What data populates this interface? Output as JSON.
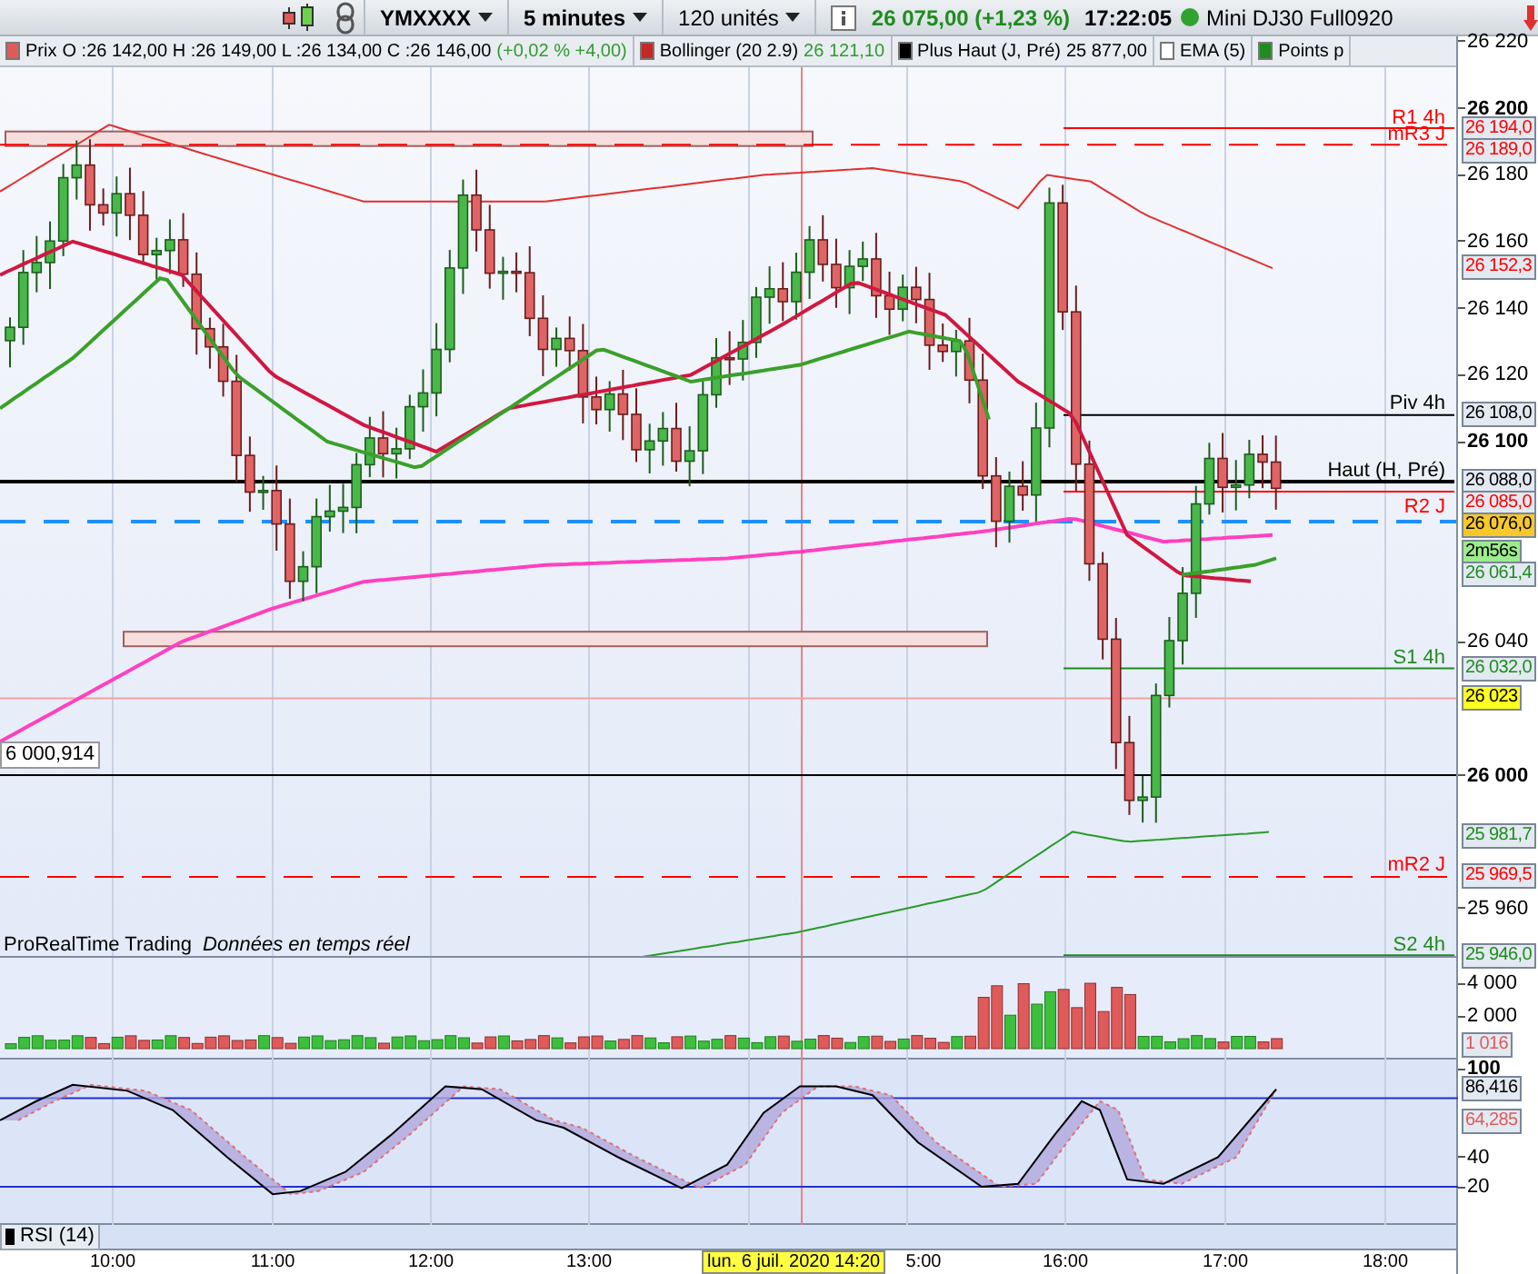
{
  "toolbar": {
    "symbol": "YMXXXX",
    "interval": "5 minutes",
    "units": "120 unités",
    "quote": "26 075,00 (+1,23 %)",
    "time": "17:22:05",
    "instrument": "Mini DJ30 Full0920"
  },
  "legend": [
    {
      "kind": "price",
      "label": "Prix",
      "text": "O :26 142,00 H :26 149,00 L :26 134,00 C :26 146,00",
      "value": "(+0,02 % +4,00)",
      "color": "#e05a5a"
    },
    {
      "kind": "indicator",
      "label": "Bollinger (20 2.9)",
      "value": "26 121,10",
      "color": "#c62828"
    },
    {
      "kind": "plain",
      "label": "Plus Haut (J, Pré)",
      "value": "25 877,00",
      "color": "#000000"
    },
    {
      "kind": "plain",
      "label": "EMA (5)",
      "color": "#ffffff"
    },
    {
      "kind": "plain",
      "label": "Points p",
      "color": "#1e8c1e"
    }
  ],
  "level_labels": [
    {
      "label": "R1 4h",
      "color": "#ff0000"
    },
    {
      "label": "mR3 J",
      "color": "#ff0000"
    },
    {
      "label": "Piv 4h",
      "color": "#000000"
    },
    {
      "label": "Haut (H, Pré)",
      "color": "#000000"
    },
    {
      "label": "R2 J",
      "color": "#ff0000"
    },
    {
      "label": "S1 4h",
      "color": "#1e8c1e"
    },
    {
      "label": "mR2 J",
      "color": "#ff0000"
    },
    {
      "label": "S2 4h",
      "color": "#1e8c1e"
    }
  ],
  "cursor_value": "6 000,914",
  "source": {
    "name": "ProRealTime Trading",
    "note": "Données en temps réel"
  },
  "rsi_label": "RSI (14)",
  "price_axis": {
    "main": {
      "ticks": [
        {
          "label": "26 220",
          "major": false
        },
        {
          "label": "26 200",
          "major": true
        },
        {
          "label": "26 180",
          "major": false
        },
        {
          "label": "26 160",
          "major": false
        },
        {
          "label": "26 140",
          "major": false
        },
        {
          "label": "26 120",
          "major": false
        },
        {
          "label": "26 100",
          "major": true
        },
        {
          "label": "26 040",
          "major": false
        },
        {
          "label": "26 000",
          "major": true
        },
        {
          "label": "25 960",
          "major": false
        }
      ],
      "badges": [
        {
          "label": "26 194,0",
          "kind": "level",
          "color": "#ff0000"
        },
        {
          "label": "26 189,0",
          "kind": "level",
          "color": "#ff0000"
        },
        {
          "label": "26 152,3",
          "kind": "level",
          "color": "#ff0000"
        },
        {
          "label": "26 108,0",
          "kind": "level",
          "color": "#000000"
        },
        {
          "label": "26 088,0",
          "kind": "level",
          "color": "#000000"
        },
        {
          "label": "26 085,0",
          "kind": "level",
          "color": "#ff0000"
        },
        {
          "label": "26 076,0",
          "kind": "current"
        },
        {
          "label": "2m56s",
          "kind": "countdown"
        },
        {
          "label": "26 061,4",
          "kind": "level",
          "color": "#1e8c1e"
        },
        {
          "label": "26 032,0",
          "kind": "level",
          "color": "#1e8c1e"
        },
        {
          "label": "26 023",
          "kind": "marker"
        },
        {
          "label": "25 981,7",
          "kind": "level",
          "color": "#1e8c1e"
        },
        {
          "label": "25 969,5",
          "kind": "level",
          "color": "#ff0000"
        },
        {
          "label": "25 946,0",
          "kind": "level",
          "color": "#1e8c1e"
        }
      ]
    },
    "volume": {
      "ticks": [
        {
          "label": "4 000",
          "major": false
        },
        {
          "label": "2 000",
          "major": false
        }
      ],
      "badges": [
        {
          "label": "1 016",
          "color": "#e05a5a"
        }
      ]
    },
    "rsi": {
      "ticks": [
        {
          "label": "100",
          "major": true
        },
        {
          "label": "40",
          "major": false
        },
        {
          "label": "20",
          "major": false
        }
      ],
      "badges": [
        {
          "label": "86,416",
          "color": "#000000"
        },
        {
          "label": "64,285",
          "color": "#e05a5a"
        }
      ]
    }
  },
  "time_axis": {
    "ticks": [
      "10:00",
      "11:00",
      "12:00",
      "13:00",
      "5:00",
      "16:00",
      "17:00",
      "18:00"
    ],
    "cursor": "lun. 6 juil. 2020 14:20"
  }
}
